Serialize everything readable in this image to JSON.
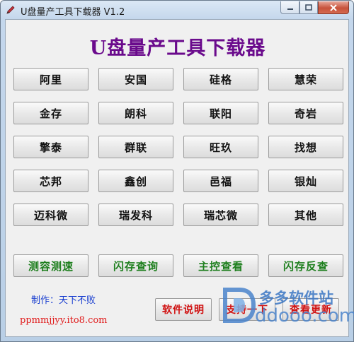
{
  "window": {
    "title": "U盘量产工具下载器 V1.2"
  },
  "heading": "U盘量产工具下载器",
  "brand_buttons": [
    [
      "阿里",
      "安国",
      "硅格",
      "慧荣"
    ],
    [
      "金存",
      "朗科",
      "联阳",
      "奇岩"
    ],
    [
      "擎泰",
      "群联",
      "旺玖",
      "找想"
    ],
    [
      "芯邦",
      "鑫创",
      "邑福",
      "银灿"
    ],
    [
      "迈科微",
      "瑞发科",
      "瑞芯微",
      "其他"
    ]
  ],
  "tool_buttons": [
    "测容测速",
    "闪存查询",
    "主控查看",
    "闪存反查"
  ],
  "footer": {
    "credit": "制作：天下不败",
    "url": "ppmmjjyy.ito8.com",
    "buttons": [
      "软件说明",
      "支持一下",
      "查看更新"
    ]
  },
  "watermark": {
    "line1": "多多软件站",
    "line2": "ddooo.com"
  },
  "colors": {
    "heading": "#6a0a8c",
    "tool_buttons": "#1e7f1e",
    "footer_buttons": "#d01010",
    "credit": "#1a3fd0",
    "url": "#e01a1a"
  }
}
